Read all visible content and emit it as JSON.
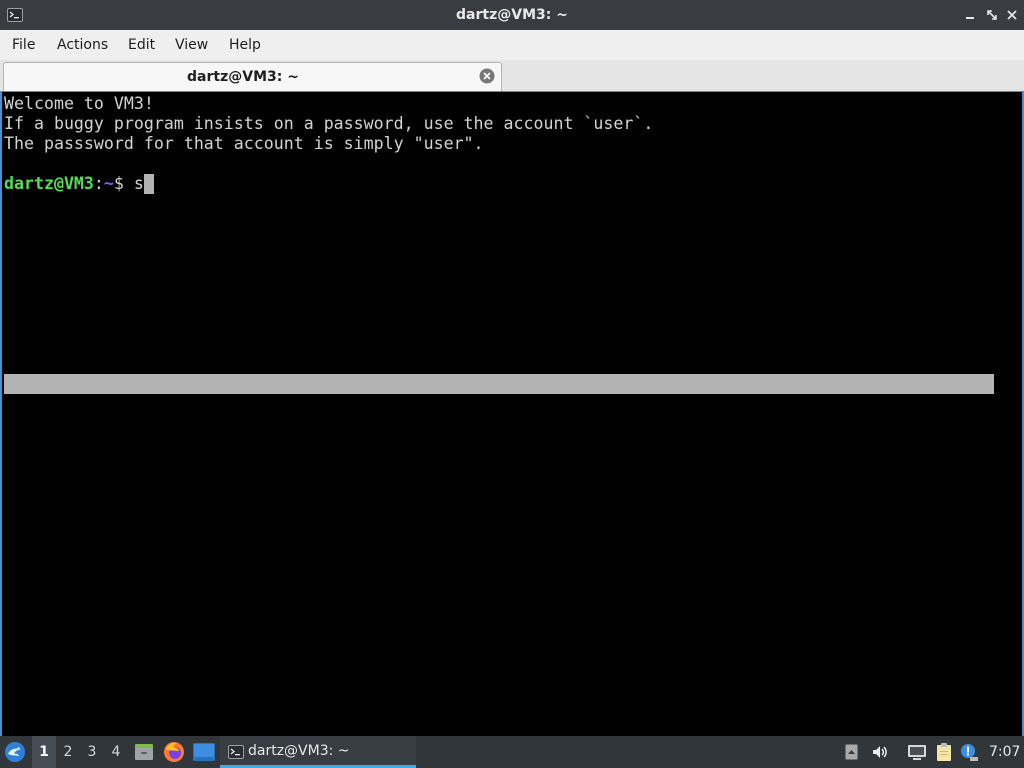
{
  "theme": {
    "titlebar_bg": "#393d42",
    "menubar_bg": "#efefef",
    "terminal_bg": "#000000",
    "terminal_fg": "#d3d3d3",
    "prompt_user_host": "#52e052",
    "prompt_path": "#5f73f7",
    "cursor": "#b2b2b2",
    "highlight_bar": "#b3b3b3",
    "taskbar_bg": "#31363b",
    "accent": "#3daee9"
  },
  "window": {
    "title": "dartz@VM3: ~",
    "icon": "terminal-icon",
    "controls": [
      "minimize-icon",
      "maximize-icon",
      "close-icon"
    ]
  },
  "menu": {
    "items": [
      "File",
      "Actions",
      "Edit",
      "View",
      "Help"
    ]
  },
  "tabs": [
    {
      "label": "dartz@VM3: ~",
      "active": true,
      "close_icon": "close-circle-icon"
    }
  ],
  "terminal": {
    "lines": [
      "Welcome to VM3!",
      "If a buggy program insists on a password, use the account `user`.",
      "The passsword for that account is simply \"user\"."
    ],
    "prompt": {
      "user_host": "dartz@VM3",
      "separator": ":",
      "path": "~",
      "symbol": "$ ",
      "input": "s"
    }
  },
  "taskbar": {
    "start_icon": "lxqt-start-icon",
    "desktops": [
      "1",
      "2",
      "3",
      "4"
    ],
    "active_desktop_index": 0,
    "quicklaunch": [
      "file-manager-icon",
      "firefox-icon",
      "show-desktop-icon"
    ],
    "tasks": [
      {
        "label": "dartz@VM3: ~",
        "icon": "terminal-icon",
        "active": true
      }
    ],
    "tray": [
      "tray-expand-icon",
      "volume-icon",
      "network-icon",
      "clipboard-icon",
      "notification-icon"
    ],
    "clock": "7:07"
  }
}
